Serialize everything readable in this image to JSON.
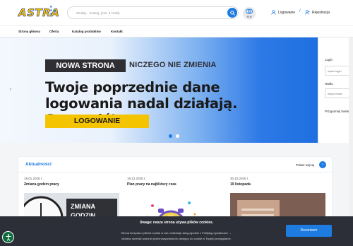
{
  "header": {
    "logo_text": "ASTRA",
    "search_placeholder": "Szukaj... Szukaj, (min. 3 znaki)",
    "language_label": "PLN",
    "login_label": "Logowanie",
    "separator": "/",
    "register_label": "Rejestracja"
  },
  "nav": {
    "items": [
      {
        "label": "Strona główna"
      },
      {
        "label": "Oferta"
      },
      {
        "label": "Katalog produktów"
      },
      {
        "label": "Kontakt"
      }
    ]
  },
  "hero": {
    "badge": "NOWA STRONA",
    "badge_sub": "NICZEGO NIE ZMIENIA",
    "headline": "Twoje poprzednie dane logowania nadal działają. Sprawdź!",
    "cta_label": "LOGOWANIE",
    "active_slide": 1,
    "slide_count": 2
  },
  "login_panel": {
    "login_label": "Login",
    "login_placeholder": "wpisz login",
    "password_label": "Hasło",
    "password_placeholder": "wpisz hasło",
    "forgot_label": "Przypomnij hasło"
  },
  "news": {
    "title": "Aktualności",
    "more_label": "Pokaż więcej",
    "items": [
      {
        "date": "19.01.2026 r.",
        "title": "Zmiana godzin pracy",
        "image_caption_line1": "ZMIANA",
        "image_caption_line2": "GODZIN"
      },
      {
        "date": "19.12.2025 r.",
        "title": "Plan pracy na najbliższy czas"
      },
      {
        "date": "30.10.2025 r.",
        "title": "10 listopada"
      }
    ]
  },
  "cookie": {
    "title": "Uwaga: nasza strona używa plików cookies.",
    "line1": "Strona korzysta z plików cookie w celu realizacji usług zgodnie z Polityką prywatności →.",
    "line2": "Możesz określić warunki przechowywania lub dostępu do cookie w Twojej przeglądarce.",
    "accept_label": "Rozumiem"
  },
  "colors": {
    "accent": "#1e7be0",
    "brand_yellow": "#f5c400",
    "dark": "#2e2e33",
    "cookie_bg": "#2c2f37"
  }
}
